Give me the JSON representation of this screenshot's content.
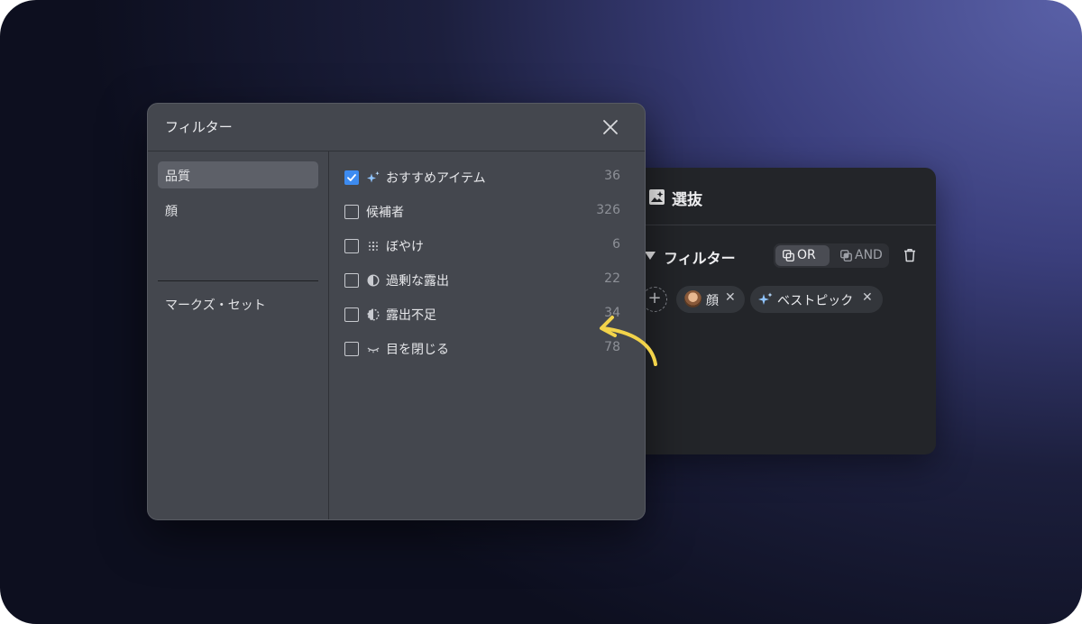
{
  "back_panel": {
    "title": "選抜",
    "filter_label": "フィルター",
    "logic": {
      "or_label": "OR",
      "and_label": "AND",
      "selected": "OR"
    },
    "chips": [
      {
        "label": "顔",
        "close": "✕"
      },
      {
        "label": "ベストピック",
        "close": "✕"
      }
    ],
    "add_label": "+"
  },
  "modal": {
    "title": "フィルター",
    "sidebar": [
      {
        "label": "品質",
        "active": true
      },
      {
        "label": "顔",
        "active": false
      },
      {
        "label": "マークズ・セット",
        "active": false
      }
    ],
    "items": [
      {
        "label": "おすすめアイテム",
        "count": "36",
        "checked": true,
        "icon": "sparkle-icon"
      },
      {
        "label": "候補者",
        "count": "326",
        "checked": false,
        "icon": ""
      },
      {
        "label": "ぼやけ",
        "count": "6",
        "checked": false,
        "icon": "blur-icon"
      },
      {
        "label": "過剰な露出",
        "count": "22",
        "checked": false,
        "icon": "overexposed-icon"
      },
      {
        "label": "露出不足",
        "count": "34",
        "checked": false,
        "icon": "underexposed-icon"
      },
      {
        "label": "目を閉じる",
        "count": "78",
        "checked": false,
        "icon": "closed-eyes-icon"
      }
    ]
  },
  "colors": {
    "accent": "#3d8bf0",
    "annotation_arrow": "#f2d34a"
  }
}
